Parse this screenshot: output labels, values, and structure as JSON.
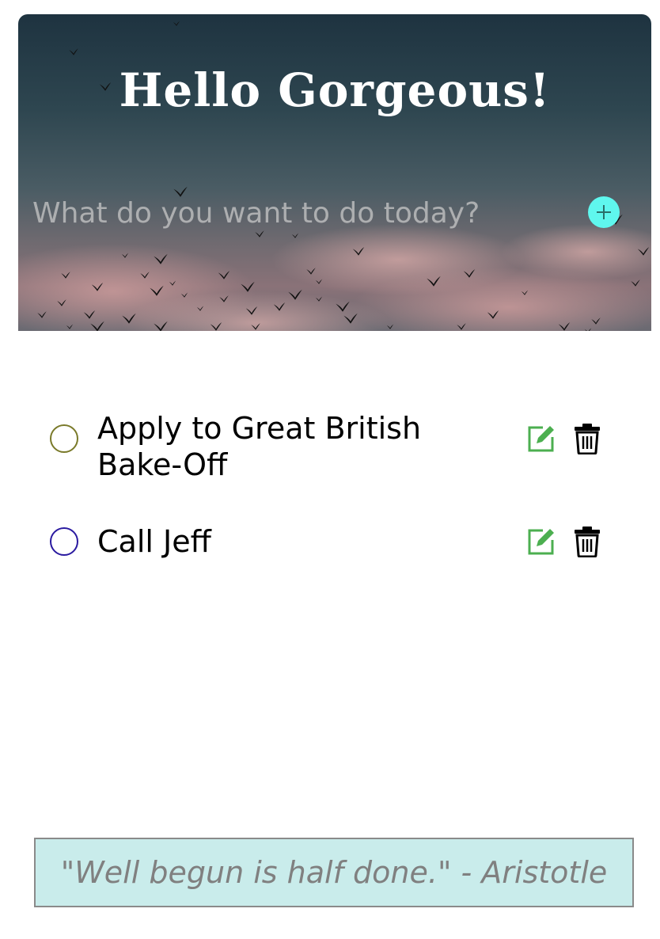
{
  "header": {
    "title": "Hello Gorgeous!"
  },
  "new_task": {
    "placeholder": "What do you want to do today?",
    "add_icon": "plus-icon"
  },
  "todos": [
    {
      "text": "Apply to Great British Bake-Off",
      "check_color": "#7a7a2a",
      "completed": false
    },
    {
      "text": "Call Jeff",
      "check_color": "#2a1aa0",
      "completed": false
    }
  ],
  "icons": {
    "edit": "edit-icon",
    "delete": "trash-icon"
  },
  "colors": {
    "add_button": "#5ff7ee",
    "edit_icon": "#4caf50",
    "quote_background": "#c9eceb"
  },
  "quote": {
    "text": "\"Well begun is half done.\" - Aristotle"
  }
}
